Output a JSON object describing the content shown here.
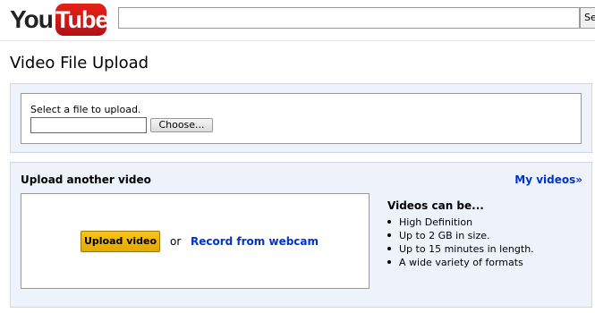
{
  "header": {
    "logo_you": "You",
    "logo_tube": "Tube",
    "search_placeholder": "",
    "search_button_label": "Se"
  },
  "page": {
    "title": "Video File Upload"
  },
  "file_panel": {
    "select_label": "Select a file to upload.",
    "file_value": "",
    "choose_label": "Choose..."
  },
  "upload_panel": {
    "heading": "Upload another video",
    "my_videos_link": "My videos»",
    "upload_button": "Upload video",
    "or_text": "or",
    "webcam_link": "Record from webcam",
    "can_be_title": "Videos can be...",
    "can_be_items": [
      "High Definition",
      "Up to 2 GB in size.",
      "Up to 15 minutes in length.",
      "A wide variety of formats"
    ]
  },
  "colors": {
    "link": "#0033cc",
    "panel_bg": "#eef3fb",
    "panel_border": "#c9d7f1",
    "upload_button": "#f0b400",
    "logo_red": "#e62117"
  }
}
